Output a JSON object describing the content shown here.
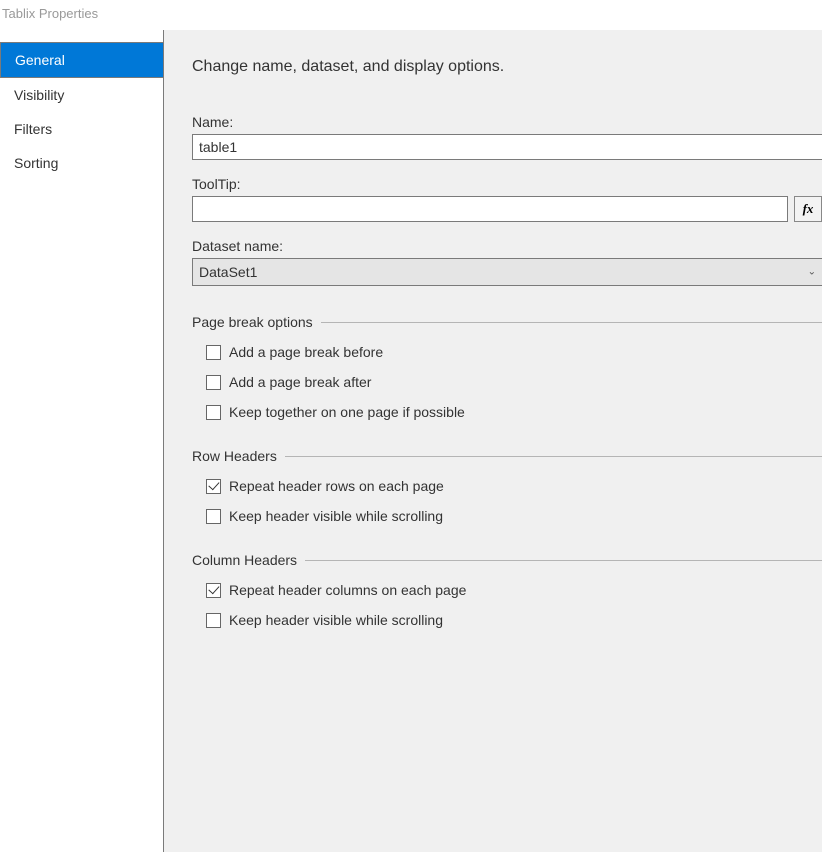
{
  "window": {
    "title": "Tablix Properties"
  },
  "sidebar": {
    "items": [
      {
        "label": "General",
        "selected": true
      },
      {
        "label": "Visibility",
        "selected": false
      },
      {
        "label": "Filters",
        "selected": false
      },
      {
        "label": "Sorting",
        "selected": false
      }
    ]
  },
  "main": {
    "heading": "Change name, dataset, and display options.",
    "name_label": "Name:",
    "name_value": "table1",
    "tooltip_label": "ToolTip:",
    "tooltip_value": "",
    "fx_label": "fx",
    "dataset_label": "Dataset name:",
    "dataset_value": "DataSet1",
    "groups": {
      "page_break": {
        "title": "Page break options",
        "items": [
          {
            "label": "Add a page break before",
            "checked": false
          },
          {
            "label": "Add a page break after",
            "checked": false
          },
          {
            "label": "Keep together on one page if possible",
            "checked": false
          }
        ]
      },
      "row_headers": {
        "title": "Row Headers",
        "items": [
          {
            "label": "Repeat header rows on each page",
            "checked": true
          },
          {
            "label": "Keep header visible while scrolling",
            "checked": false
          }
        ]
      },
      "column_headers": {
        "title": "Column Headers",
        "items": [
          {
            "label": "Repeat header columns on each page",
            "checked": true
          },
          {
            "label": "Keep header visible while scrolling",
            "checked": false
          }
        ]
      }
    }
  }
}
